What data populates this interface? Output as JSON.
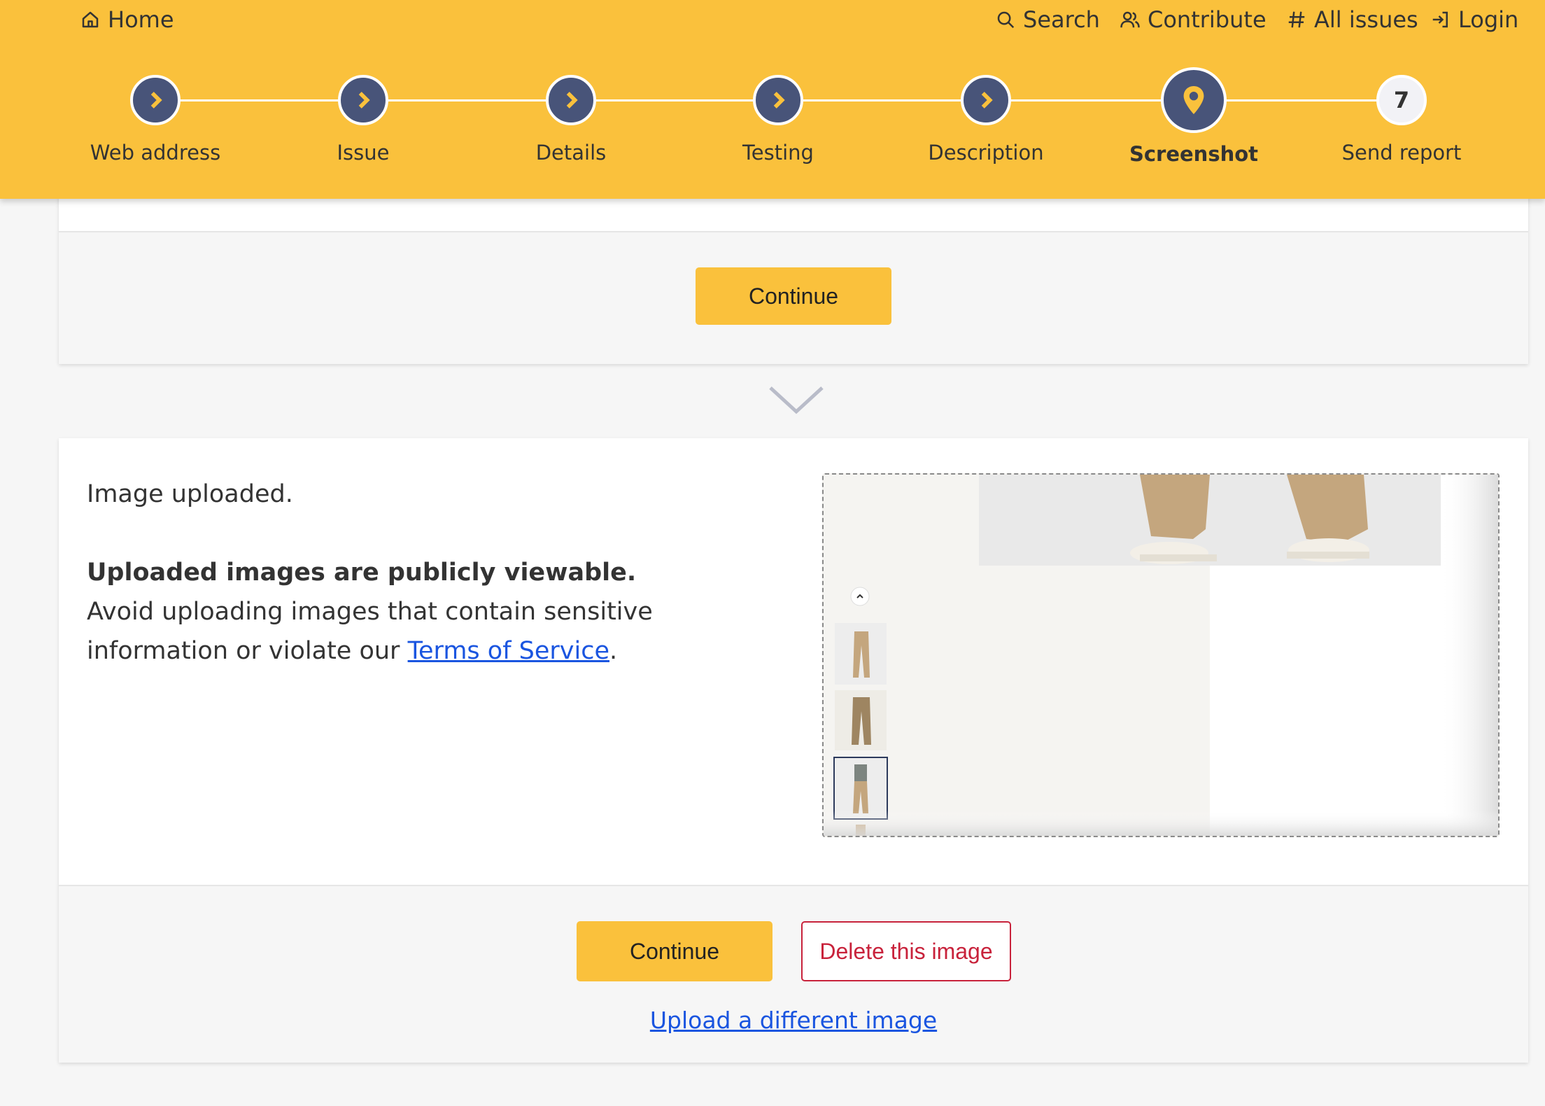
{
  "nav": {
    "home": "Home",
    "search": "Search",
    "contribute": "Contribute",
    "all_issues": "All issues",
    "login": "Login"
  },
  "steps": [
    {
      "label": "Web address",
      "state": "done"
    },
    {
      "label": "Issue",
      "state": "done"
    },
    {
      "label": "Details",
      "state": "done"
    },
    {
      "label": "Testing",
      "state": "done"
    },
    {
      "label": "Description",
      "state": "done"
    },
    {
      "label": "Screenshot",
      "state": "current"
    },
    {
      "label": "Send report",
      "state": "future",
      "number": "7"
    }
  ],
  "top_card": {
    "continue_label": "Continue"
  },
  "upload": {
    "status": "Image uploaded.",
    "warning_title": "Uploaded images are publicly viewable.",
    "warning_text": "Avoid uploading images that contain sensitive information or violate our",
    "tos_link": "Terms of Service",
    "tos_suffix": ".",
    "continue_label": "Continue",
    "delete_label": "Delete this image",
    "upload_different": "Upload a different image"
  },
  "colors": {
    "header_bg": "#fac13c",
    "step_done": "#485479",
    "danger": "#c8223b",
    "link": "#1a55e0"
  }
}
